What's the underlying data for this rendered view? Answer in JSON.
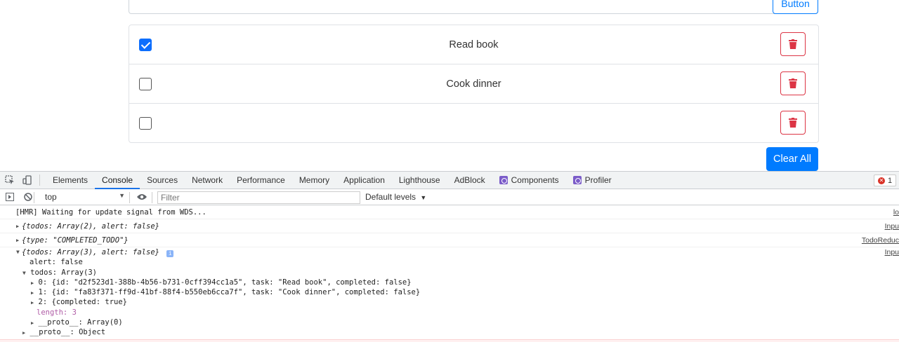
{
  "app": {
    "add_button": "Button",
    "todos": [
      {
        "task": "Read book",
        "checked": true
      },
      {
        "task": "Cook dinner",
        "checked": false
      },
      {
        "task": "",
        "checked": false
      }
    ],
    "clear_all": "Clear All",
    "colors": {
      "primary": "#007bff",
      "danger": "#dc3545"
    }
  },
  "devtools": {
    "tabs": [
      "Elements",
      "Console",
      "Sources",
      "Network",
      "Performance",
      "Memory",
      "Application",
      "Lighthouse",
      "AdBlock",
      "Components",
      "Profiler"
    ],
    "active_tab": "Console",
    "error_count": "1",
    "context": "top",
    "filter_placeholder": "Filter",
    "levels": "Default levels",
    "logs": {
      "hmr": "[HMR] Waiting for update signal from WDS...",
      "hmr_src": "lo",
      "log1": "{todos: Array(2), alert: false}",
      "log1_src": "Inpu",
      "log2": "{type: \"COMPLETED_TODO\"}",
      "log2_src": "TodoReduc",
      "log3": "{todos: Array(3), alert: false}",
      "log3_src": "Inpu",
      "alert_line": "alert: false",
      "todos_line": "todos: Array(3)",
      "item0": "0: {id: \"d2f523d1-388b-4b56-b731-0cff394cc1a5\", task: \"Read book\", completed: false}",
      "item1": "1: {id: \"fa83f371-ff9d-41bf-88f4-b550eb6cca7f\", task: \"Cook dinner\", completed: false}",
      "item2": "2: {completed: true}",
      "length_line": "length: 3",
      "proto_arr": "__proto__: Array(0)",
      "proto_obj": "__proto__: Object"
    }
  }
}
